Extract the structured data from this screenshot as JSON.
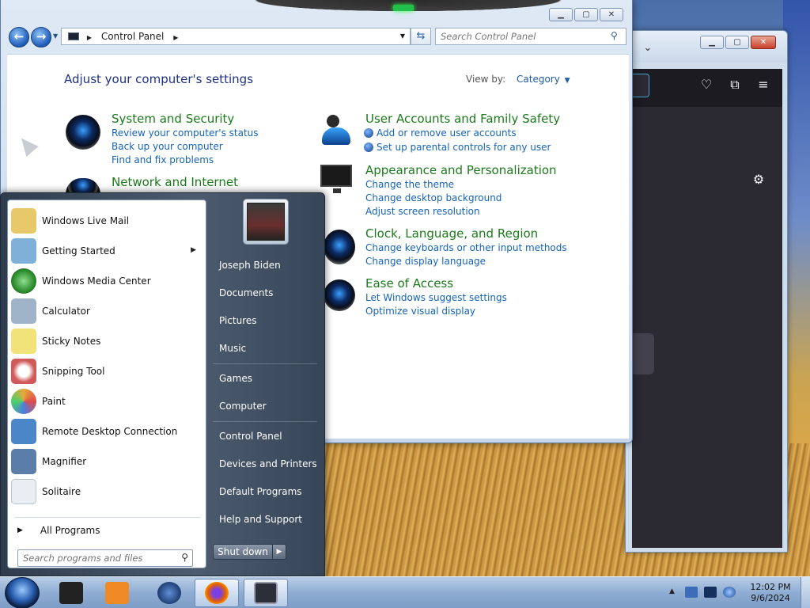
{
  "control_panel": {
    "address": {
      "crumb": "Control Panel"
    },
    "search_placeholder": "Search Control Panel",
    "heading": "Adjust your computer's settings",
    "view_by_label": "View by:",
    "view_by_value": "Category",
    "categories": [
      {
        "title": "System and Security",
        "links": [
          "Review your computer's status",
          "Back up your computer",
          "Find and fix problems"
        ],
        "icon": "shield-globe-icon"
      },
      {
        "title": "Network and Internet",
        "links": [],
        "icon": "network-globe-icon"
      },
      {
        "title": "User Accounts and Family Safety",
        "links": [
          "Add or remove user accounts",
          "Set up parental controls for any user"
        ],
        "icon": "users-icon"
      },
      {
        "title": "Appearance and Personalization",
        "links": [
          "Change the theme",
          "Change desktop background",
          "Adjust screen resolution"
        ],
        "icon": "monitor-icon"
      },
      {
        "title": "Clock, Language, and Region",
        "links": [
          "Change keyboards or other input methods",
          "Change display language"
        ],
        "icon": "clock-globe-icon"
      },
      {
        "title": "Ease of Access",
        "links": [
          "Let Windows suggest settings",
          "Optimize visual display"
        ],
        "icon": "ease-of-access-icon"
      }
    ]
  },
  "start_menu": {
    "programs": [
      {
        "label": "Windows Live Mail",
        "icon": "mail-icon",
        "color": "#e8c96a"
      },
      {
        "label": "Getting Started",
        "icon": "getting-started-icon",
        "color": "#7fb0d8",
        "submenu": true
      },
      {
        "label": "Windows Media Center",
        "icon": "media-center-icon",
        "color": "#3a9d3a"
      },
      {
        "label": "Calculator",
        "icon": "calculator-icon",
        "color": "#9fb4c8"
      },
      {
        "label": "Sticky Notes",
        "icon": "sticky-notes-icon",
        "color": "#f2e27a"
      },
      {
        "label": "Snipping Tool",
        "icon": "snipping-tool-icon",
        "color": "#d05a5a"
      },
      {
        "label": "Paint",
        "icon": "paint-icon",
        "color": "#e7a83a"
      },
      {
        "label": "Remote Desktop Connection",
        "icon": "remote-desktop-icon",
        "color": "#4a86c8"
      },
      {
        "label": "Magnifier",
        "icon": "magnifier-icon",
        "color": "#5b7ea8"
      },
      {
        "label": "Solitaire",
        "icon": "solitaire-icon",
        "color": "#e9eef3"
      }
    ],
    "all_programs": "All Programs",
    "search_placeholder": "Search programs and files",
    "right": {
      "user": "Joseph Biden",
      "items": [
        "Documents",
        "Pictures",
        "Music",
        "Games",
        "Computer",
        "Control Panel",
        "Devices and Printers",
        "Default Programs",
        "Help and Support"
      ]
    },
    "shutdown": "Shut down"
  },
  "taskbar": {
    "apps": [
      {
        "name": "terminal",
        "icon": "terminal-icon",
        "color": "#222222"
      },
      {
        "name": "media-player",
        "icon": "media-player-icon",
        "color": "#f08a24"
      },
      {
        "name": "ie",
        "icon": "globe-icon",
        "color": "#1f3f73"
      },
      {
        "name": "firefox",
        "icon": "firefox-icon",
        "color": "#e66000",
        "active": true
      },
      {
        "name": "control-panel",
        "icon": "control-panel-icon",
        "color": "#2a2f3a",
        "active": true
      }
    ],
    "clock_time": "12:02 PM",
    "clock_date": "9/6/2024"
  }
}
